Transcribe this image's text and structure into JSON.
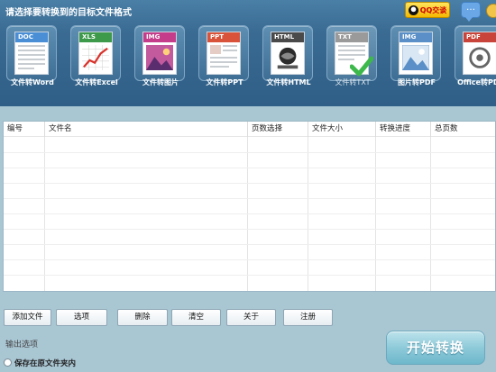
{
  "header": {
    "title": "请选择要转换到的目标文件格式",
    "qq_label": "QQ交谈"
  },
  "formats": [
    {
      "tag": "DOC",
      "label": "文件转Word",
      "color": "#4a8fd6"
    },
    {
      "tag": "XLS",
      "label": "文件转Excel",
      "color": "#3c9a4a"
    },
    {
      "tag": "IMG",
      "label": "文件转图片",
      "color": "#c43c8a"
    },
    {
      "tag": "PPT",
      "label": "文件转PPT",
      "color": "#d9533a"
    },
    {
      "tag": "HTML",
      "label": "文件转HTML",
      "color": "#4a4a4a"
    },
    {
      "tag": "TXT",
      "label": "文件转TXT",
      "color": "#9a9a9a"
    },
    {
      "tag": "IMG",
      "label": "图片转PDF",
      "color": "#5a8fc7"
    },
    {
      "tag": "PDF",
      "label": "Office转PDF",
      "color": "#c9443a"
    }
  ],
  "table": {
    "columns": [
      "编号",
      "文件名",
      "页数选择",
      "文件大小",
      "转换进度",
      "总页数"
    ],
    "rows": []
  },
  "buttons": {
    "add": "添加文件",
    "options": "选项",
    "delete": "删除",
    "clear": "清空",
    "about": "关于",
    "register": "注册"
  },
  "output": {
    "section_label": "输出选项",
    "save_original": "保存在原文件夹内"
  },
  "start_label": "开始转换"
}
